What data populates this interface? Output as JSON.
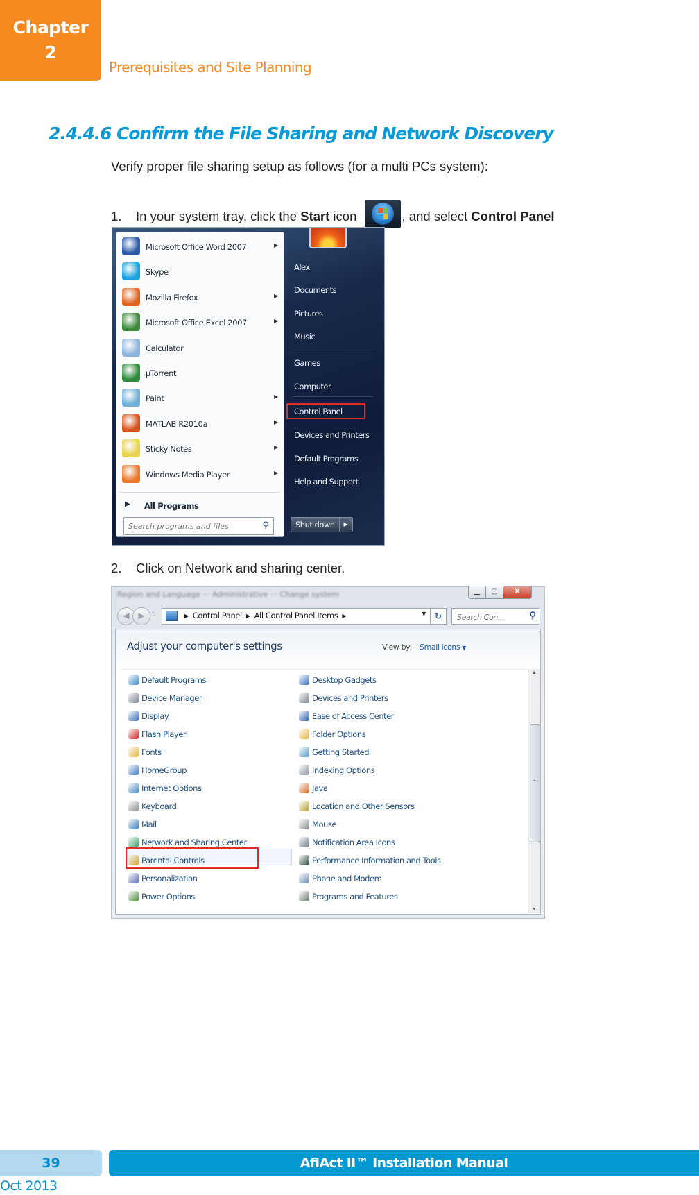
{
  "header": {
    "chapter_label": "Chapter",
    "chapter_number": "2",
    "chapter_title": "Prerequisites and Site Planning"
  },
  "section": {
    "heading": "2.4.4.6 Confirm the File Sharing and Network Discovery",
    "intro": "Verify proper file sharing setup as follows (for a multi PCs system):",
    "step1": {
      "number": "1.",
      "text_before": "In your system tray, click the ",
      "bold_start": "Start",
      "text_icon": " icon ",
      "text_after": ", and select ",
      "bold_target": "Control Panel",
      "icon": "windows-start-orb-icon"
    },
    "step2": {
      "number": "2.",
      "text": "Click on Network and sharing center."
    }
  },
  "start_menu": {
    "programs": [
      {
        "label": "Microsoft Office Word 2007",
        "icon": "word-icon",
        "color": "#2a5aa8",
        "submenu": true
      },
      {
        "label": "Skype",
        "icon": "skype-icon",
        "color": "#1aa3e0",
        "submenu": false
      },
      {
        "label": "Mozilla Firefox",
        "icon": "firefox-icon",
        "color": "#e0641e",
        "submenu": true
      },
      {
        "label": "Microsoft Office Excel 2007",
        "icon": "excel-icon",
        "color": "#3d8a3a",
        "submenu": true
      },
      {
        "label": "Calculator",
        "icon": "calculator-icon",
        "color": "#8db6de",
        "submenu": false
      },
      {
        "label": "µTorrent",
        "icon": "utorrent-icon",
        "color": "#2e8b3a",
        "submenu": false
      },
      {
        "label": "Paint",
        "icon": "paint-icon",
        "color": "#6fb0d8",
        "submenu": true
      },
      {
        "label": "MATLAB R2010a",
        "icon": "matlab-icon",
        "color": "#d9541c",
        "submenu": true
      },
      {
        "label": "Sticky Notes",
        "icon": "sticky-notes-icon",
        "color": "#e8d34a",
        "submenu": true
      },
      {
        "label": "Windows Media Player",
        "icon": "media-player-icon",
        "color": "#e9782a",
        "submenu": true
      }
    ],
    "all_programs": "All Programs",
    "search_placeholder": "Search programs and files",
    "right_items": [
      "Alex",
      "Documents",
      "Pictures",
      "Music",
      "Games",
      "Computer",
      "Control Panel",
      "Devices and Printers",
      "Default Programs",
      "Help and Support"
    ],
    "highlighted_item": "Control Panel",
    "shutdown_label": "Shut down"
  },
  "control_panel": {
    "window_title_blurred": "Region and Language ··· Administrative ··· Change system",
    "breadcrumbs": [
      "Control Panel",
      "All Control Panel Items"
    ],
    "search_placeholder": "Search Con...",
    "heading": "Adjust your computer's settings",
    "view_by_label": "View by:",
    "view_by_value": "Small icons",
    "highlighted_item": "Network and Sharing Center",
    "left_column": [
      {
        "label": "Default Programs",
        "icon": "default-programs-icon",
        "color": "#3d8ac8"
      },
      {
        "label": "Device Manager",
        "icon": "device-manager-icon",
        "color": "#7a8490"
      },
      {
        "label": "Display",
        "icon": "display-icon",
        "color": "#3a6eb8"
      },
      {
        "label": "Flash Player",
        "icon": "flash-player-icon",
        "color": "#c8201e"
      },
      {
        "label": "Fonts",
        "icon": "fonts-icon",
        "color": "#e1b43a"
      },
      {
        "label": "HomeGroup",
        "icon": "homegroup-icon",
        "color": "#3a7ac0"
      },
      {
        "label": "Internet Options",
        "icon": "internet-options-icon",
        "color": "#4a8ac0"
      },
      {
        "label": "Keyboard",
        "icon": "keyboard-icon",
        "color": "#8a8f96"
      },
      {
        "label": "Mail",
        "icon": "mail-icon",
        "color": "#3a7ab8"
      },
      {
        "label": "Network and Sharing Center",
        "icon": "network-icon",
        "color": "#3a9a6a"
      },
      {
        "label": "Parental Controls",
        "icon": "parental-controls-icon",
        "color": "#d0a030"
      },
      {
        "label": "Personalization",
        "icon": "personalization-icon",
        "color": "#5a6ab8"
      },
      {
        "label": "Power Options",
        "icon": "power-options-icon",
        "color": "#4a8a3a"
      }
    ],
    "right_column": [
      {
        "label": "Desktop Gadgets",
        "icon": "desktop-gadgets-icon",
        "color": "#3a70c0"
      },
      {
        "label": "Devices and Printers",
        "icon": "devices-printers-icon",
        "color": "#7a8490"
      },
      {
        "label": "Ease of Access Center",
        "icon": "ease-of-access-icon",
        "color": "#2a5aa8"
      },
      {
        "label": "Folder Options",
        "icon": "folder-options-icon",
        "color": "#e1b43a"
      },
      {
        "label": "Getting Started",
        "icon": "getting-started-icon",
        "color": "#5a9ac8"
      },
      {
        "label": "Indexing Options",
        "icon": "indexing-options-icon",
        "color": "#8a9099"
      },
      {
        "label": "Java",
        "icon": "java-icon",
        "color": "#d46a2a"
      },
      {
        "label": "Location and Other Sensors",
        "icon": "location-sensors-icon",
        "color": "#b0a030"
      },
      {
        "label": "Mouse",
        "icon": "mouse-icon",
        "color": "#8a8f96"
      },
      {
        "label": "Notification Area Icons",
        "icon": "notification-area-icon",
        "color": "#6a7a8a"
      },
      {
        "label": "Performance Information and Tools",
        "icon": "performance-icon",
        "color": "#2a4a3a"
      },
      {
        "label": "Phone and Modem",
        "icon": "phone-modem-icon",
        "color": "#6a8ab0"
      },
      {
        "label": "Programs and Features",
        "icon": "programs-features-icon",
        "color": "#6a7a6a"
      }
    ]
  },
  "footer": {
    "page_number": "39",
    "manual_title": "AfiAct II™ Installation Manual",
    "date": "Oct 2013"
  },
  "colors": {
    "accent_orange": "#f58a20",
    "accent_blue": "#0599d4",
    "page_box_blue": "#b4d8ee",
    "highlight_red": "#e52a2a"
  }
}
